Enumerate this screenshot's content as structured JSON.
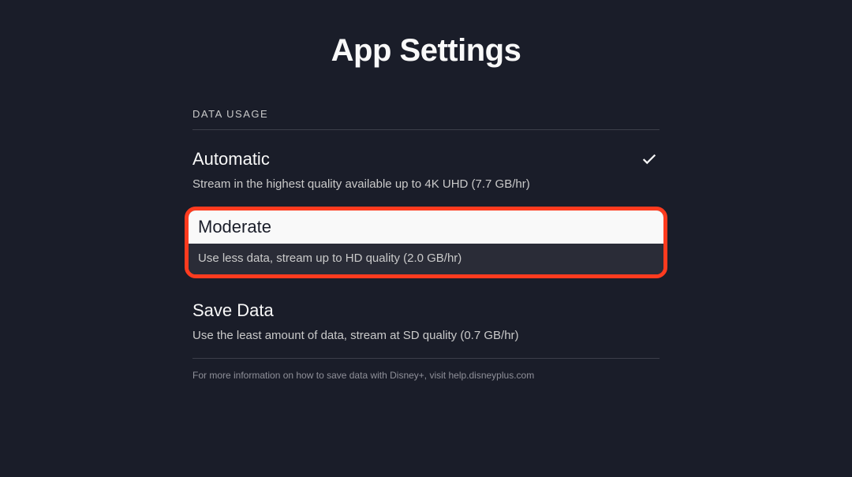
{
  "page_title": "App Settings",
  "section_header": "DATA USAGE",
  "options": [
    {
      "title": "Automatic",
      "desc": "Stream in the highest quality available up to 4K UHD (7.7 GB/hr)",
      "selected": true,
      "highlighted": false
    },
    {
      "title": "Moderate",
      "desc": "Use less data, stream up to HD quality (2.0 GB/hr)",
      "selected": false,
      "highlighted": true
    },
    {
      "title": "Save Data",
      "desc": "Use the least amount of data, stream at SD quality (0.7 GB/hr)",
      "selected": false,
      "highlighted": false
    }
  ],
  "footer_note": "For more information on how to save data with Disney+, visit help.disneyplus.com"
}
